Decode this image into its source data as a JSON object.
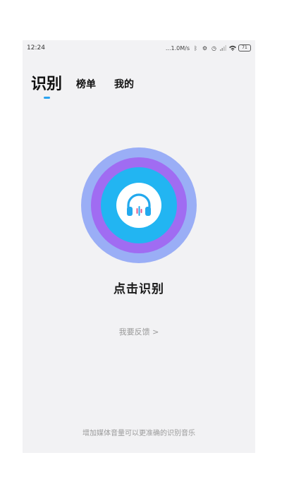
{
  "status_bar": {
    "time": "12:24",
    "network_speed": "...1.0M/s",
    "battery_level": "71",
    "icons": [
      "bluetooth-icon",
      "alarm-icon",
      "clock-icon",
      "signal-icon",
      "wifi-icon",
      "battery-icon"
    ]
  },
  "tabs": [
    {
      "label": "识别",
      "active": true
    },
    {
      "label": "榜单",
      "active": false
    },
    {
      "label": "我的",
      "active": false
    }
  ],
  "recognize": {
    "label": "点击识别",
    "icon": "headphone-icon"
  },
  "feedback": {
    "label": "我要反馈 >"
  },
  "hint": {
    "text": "增加媒体音量可以更准确的识别音乐"
  },
  "colors": {
    "background": "#f2f2f4",
    "ring_outer": "#9aaef6",
    "ring_middle": "#a06cf2",
    "ring_inner": "#22b5f2",
    "accent": "#2aa3f0"
  }
}
